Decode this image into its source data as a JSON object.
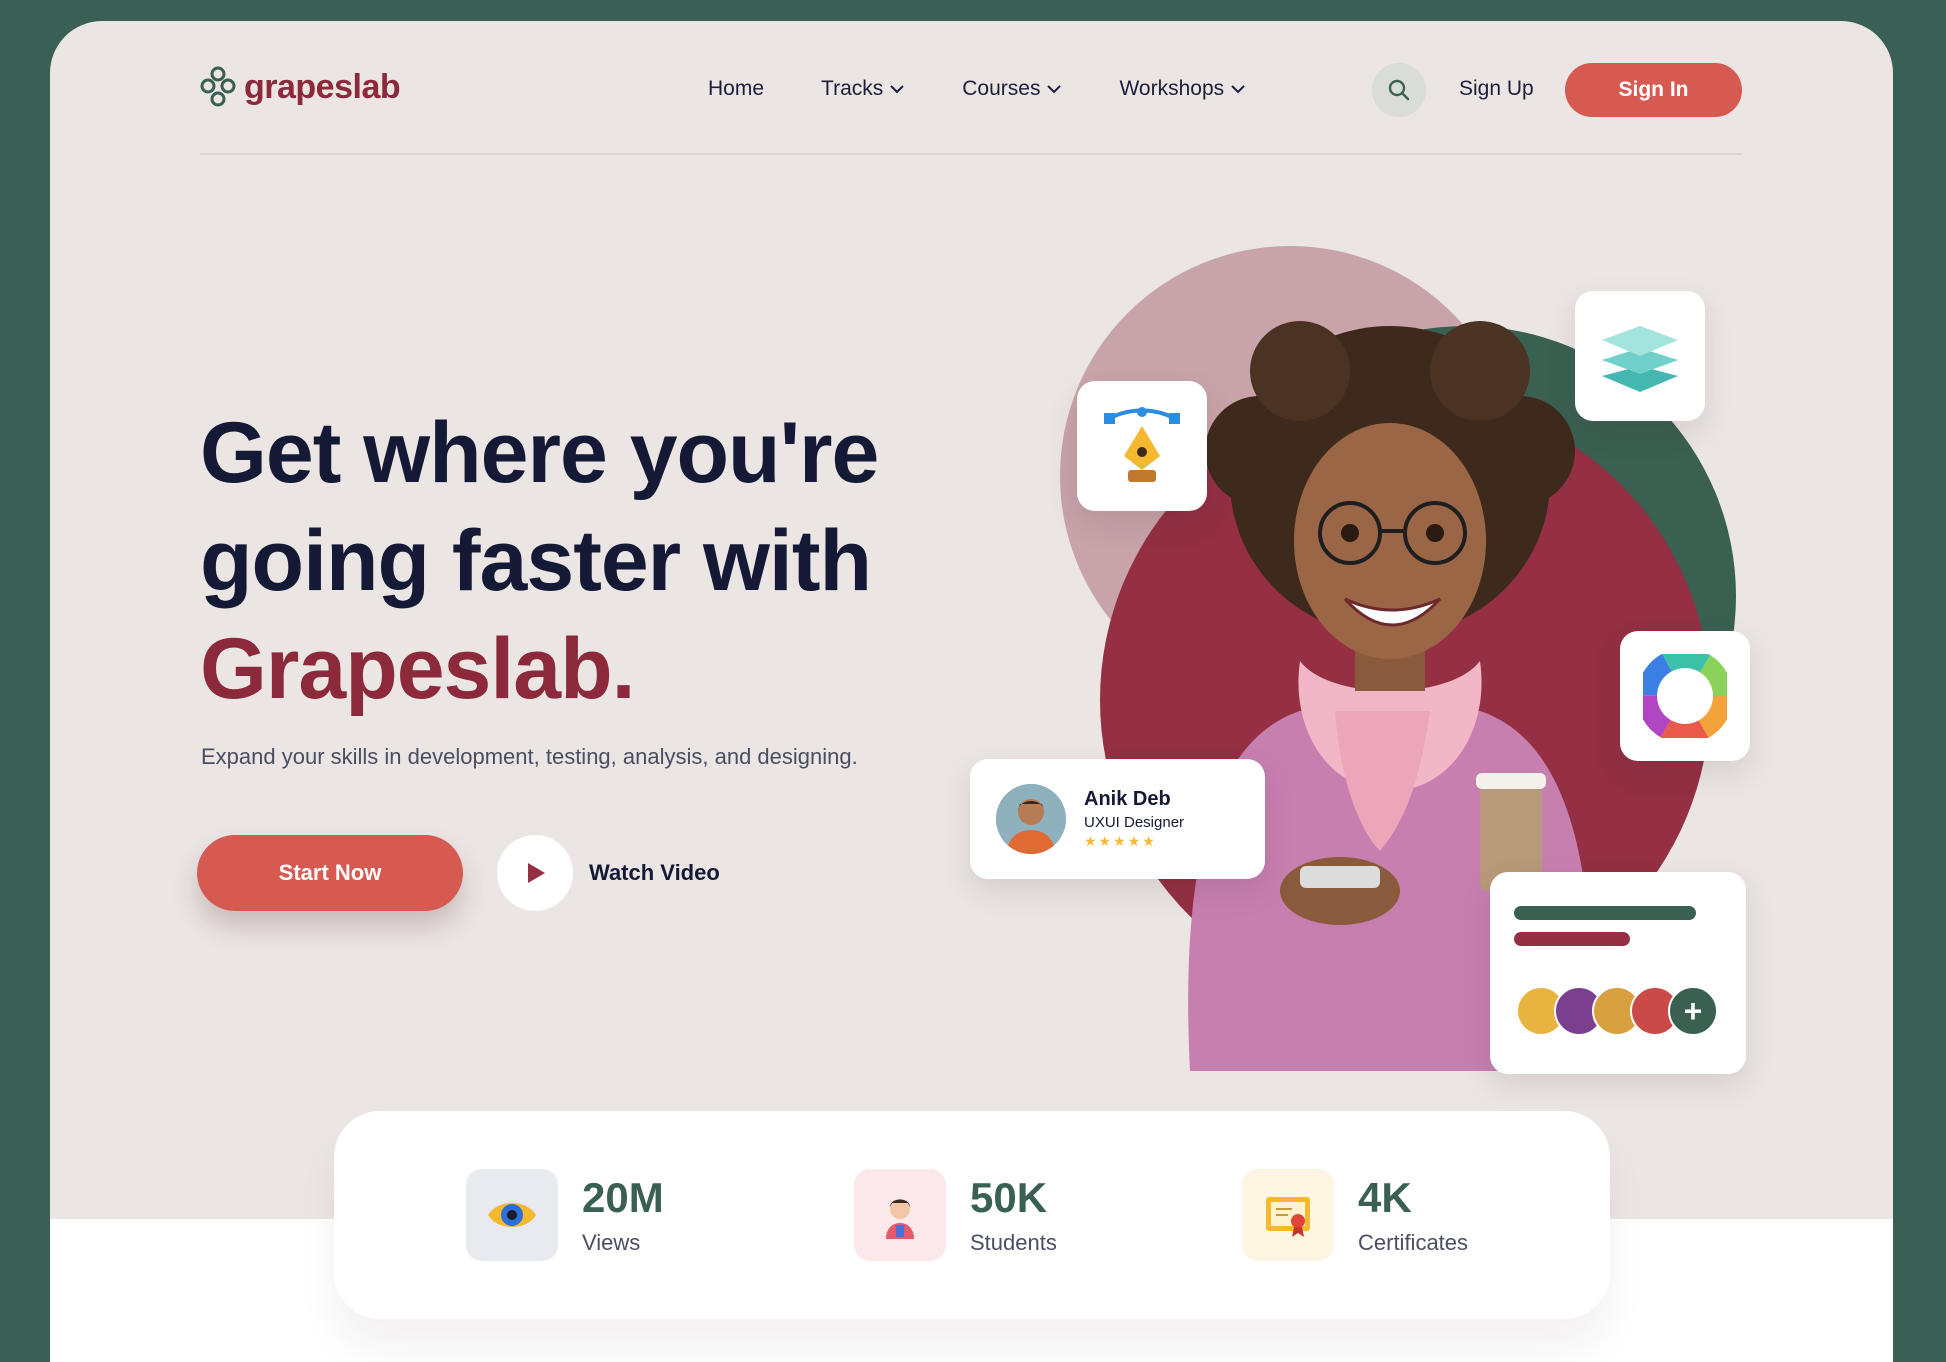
{
  "brand": {
    "name": "grapeslab",
    "color": "#8c2a3c"
  },
  "nav": {
    "items": [
      {
        "label": "Home",
        "has_dropdown": false
      },
      {
        "label": "Tracks",
        "has_dropdown": true
      },
      {
        "label": "Courses",
        "has_dropdown": true
      },
      {
        "label": "Workshops",
        "has_dropdown": true
      }
    ],
    "search_icon": "search-icon",
    "signup_label": "Sign Up",
    "signin_label": "Sign In"
  },
  "hero": {
    "headline_line1": "Get where you're",
    "headline_line2": "going faster with",
    "headline_brand": "Grapeslab.",
    "subtitle": "Expand your skills in development, testing, analysis, and designing.",
    "start_label": "Start Now",
    "watch_label": "Watch Video"
  },
  "profile": {
    "name": "Anik Deb",
    "role": "UXUI Designer",
    "rating": 5,
    "stars": "★★★★★"
  },
  "floating_icons": [
    "pen-tool-icon",
    "layers-icon",
    "color-wheel-icon"
  ],
  "team": {
    "avatars": 4,
    "plus": "+"
  },
  "stats": [
    {
      "value": "20M",
      "label": "Views",
      "icon": "eye-icon"
    },
    {
      "value": "50K",
      "label": "Students",
      "icon": "student-icon"
    },
    {
      "value": "4K",
      "label": "Certificates",
      "icon": "certificate-icon"
    }
  ],
  "colors": {
    "accent": "#d65a52",
    "brand": "#8c2a3c",
    "green": "#3a6052",
    "background": "#ebe5e3",
    "frame": "#3a5f54"
  }
}
